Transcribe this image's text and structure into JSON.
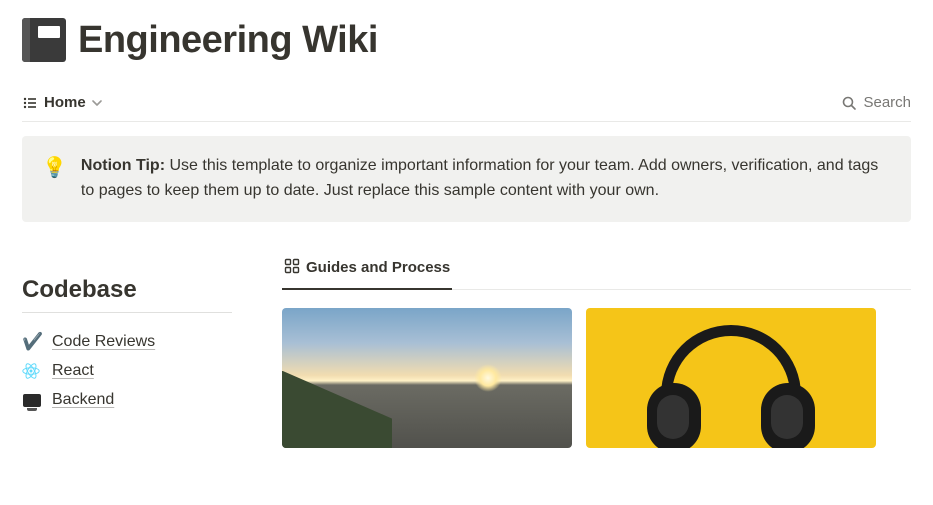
{
  "page": {
    "title": "Engineering Wiki"
  },
  "toolbar": {
    "view_label": "Home",
    "search_label": "Search"
  },
  "callout": {
    "icon": "💡",
    "tip_label": "Notion Tip:",
    "body": "Use this template to organize important information for your team. Add owners, verification, and tags to pages to keep them up to date. Just replace this sample content with your own."
  },
  "sidebar": {
    "heading": "Codebase",
    "items": [
      {
        "icon": "✔️",
        "label": "Code Reviews"
      },
      {
        "icon": "react",
        "label": "React"
      },
      {
        "icon": "monitor",
        "label": "Backend"
      }
    ]
  },
  "main": {
    "tab_label": "Guides and Process"
  }
}
